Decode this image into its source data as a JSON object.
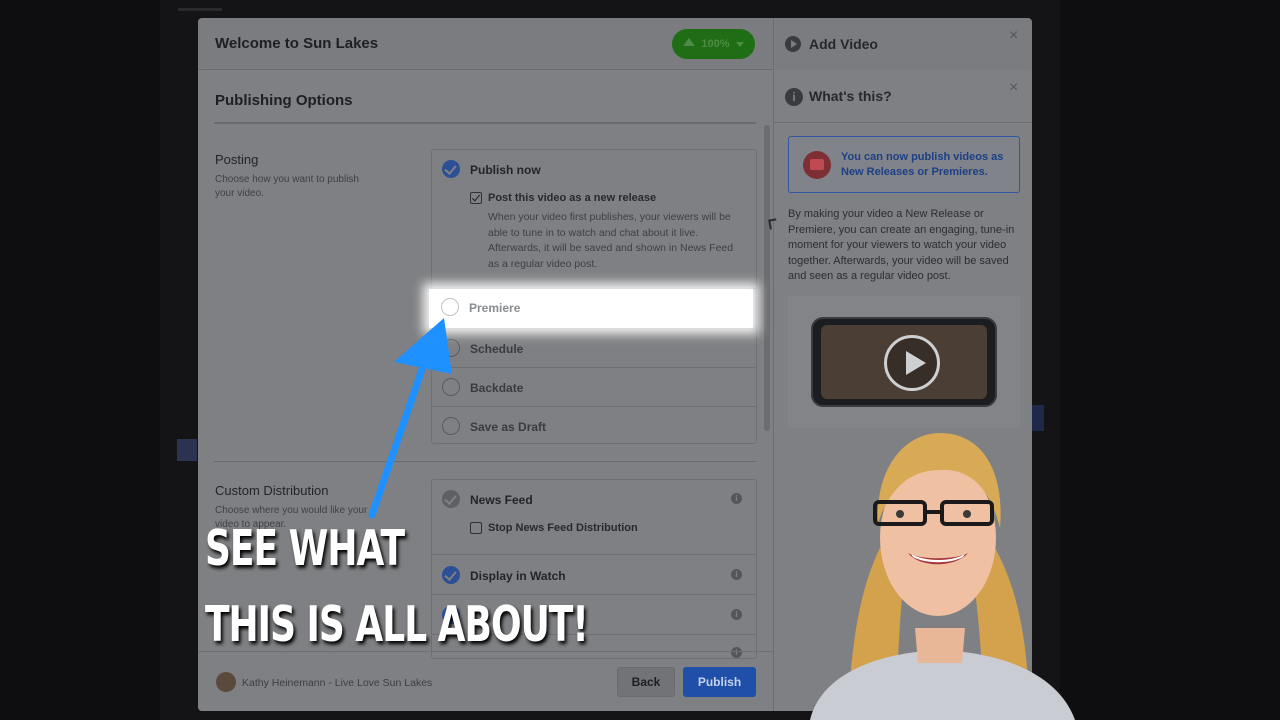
{
  "outer_modal": {
    "title": "Welcome to Sun Lakes",
    "upload_percent": "100%",
    "side_title": "Add Video",
    "close_symbol": "×"
  },
  "publishing": {
    "title": "Publishing Options",
    "posting": {
      "label": "Posting",
      "description": "Choose how you want to publish your video.",
      "publish_now": "Publish now",
      "new_release_checkbox": "Post this video as a new release",
      "new_release_description": "When your video first publishes, your viewers will be able to tune in to watch and chat about it live. Afterwards, it will be saved and shown in News Feed as a regular video post.",
      "options": [
        "Premiere",
        "Schedule",
        "Backdate",
        "Save as Draft"
      ]
    },
    "custom_distribution": {
      "label": "Custom Distribution",
      "description": "Choose where you would like your video to appear.",
      "news_feed": "News Feed",
      "stop_news_feed": "Stop News Feed Distribution",
      "display_in_watch": "Display in Watch"
    },
    "footer": {
      "page_name": "Kathy Heinemann - Live Love Sun Lakes",
      "back": "Back",
      "publish": "Publish"
    }
  },
  "side_panel": {
    "title": "What's this?",
    "info_glyph": "i",
    "close_symbol": "×",
    "banner": "You can now publish videos as New Releases or Premieres.",
    "body": "By making your video a New Release or Premiere, you can create an engaging, tune-in moment for your viewers to watch your video together. Afterwards, your video will be saved and seen as a regular video post."
  },
  "caption": {
    "line1": "SEE WHAT",
    "line2": "THIS IS ALL ABOUT!"
  },
  "colors": {
    "arrow": "#1e90ff",
    "publish_button": "#1f4fa8",
    "upload_pill": "#1f6e15"
  }
}
